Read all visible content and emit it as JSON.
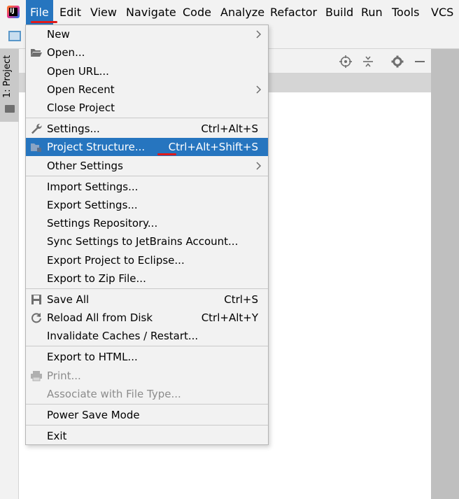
{
  "menubar": {
    "items": [
      {
        "label": "File",
        "mnemonic": "F"
      },
      {
        "label": "Edit",
        "mnemonic": "E"
      },
      {
        "label": "View",
        "mnemonic": "V"
      },
      {
        "label": "Navigate",
        "mnemonic": "N"
      },
      {
        "label": "Code",
        "mnemonic": "C"
      },
      {
        "label": "Analyze",
        "mnemonic": "z"
      },
      {
        "label": "Refactor",
        "mnemonic": "R"
      },
      {
        "label": "Build",
        "mnemonic": "B"
      },
      {
        "label": "Run",
        "mnemonic": "u"
      },
      {
        "label": "Tools",
        "mnemonic": "T"
      },
      {
        "label": "VCS",
        "mnemonic": "S"
      }
    ],
    "active": "File"
  },
  "sidebar": {
    "project_tab_label": "1: Project"
  },
  "file_menu": {
    "groups": [
      [
        {
          "label": "New",
          "submenu": true
        },
        {
          "label": "Open...",
          "icon": "open-folder-icon"
        },
        {
          "label": "Open URL..."
        },
        {
          "label": "Open Recent",
          "submenu": true
        },
        {
          "label": "Close Project"
        }
      ],
      [
        {
          "label": "Settings...",
          "shortcut": "Ctrl+Alt+S",
          "icon": "wrench-icon"
        },
        {
          "label": "Project Structure...",
          "shortcut": "Ctrl+Alt+Shift+S",
          "icon": "project-structure-icon",
          "selected": true
        },
        {
          "label": "Other Settings",
          "submenu": true
        }
      ],
      [
        {
          "label": "Import Settings..."
        },
        {
          "label": "Export Settings..."
        },
        {
          "label": "Settings Repository..."
        },
        {
          "label": "Sync Settings to JetBrains Account..."
        },
        {
          "label": "Export Project to Eclipse..."
        },
        {
          "label": "Export to Zip File..."
        }
      ],
      [
        {
          "label": "Save All",
          "shortcut": "Ctrl+S",
          "icon": "save-icon"
        },
        {
          "label": "Reload All from Disk",
          "shortcut": "Ctrl+Alt+Y",
          "icon": "reload-icon"
        },
        {
          "label": "Invalidate Caches / Restart..."
        }
      ],
      [
        {
          "label": "Export to HTML..."
        },
        {
          "label": "Print...",
          "disabled": true,
          "icon": "printer-icon"
        },
        {
          "label": "Associate with File Type...",
          "disabled": true
        }
      ],
      [
        {
          "label": "Power Save Mode"
        }
      ],
      [
        {
          "label": "Exit"
        }
      ]
    ]
  },
  "colors": {
    "selection": "#2675bf",
    "annotation_marker": "#e01a1a",
    "menu_background": "#f2f2f2"
  }
}
